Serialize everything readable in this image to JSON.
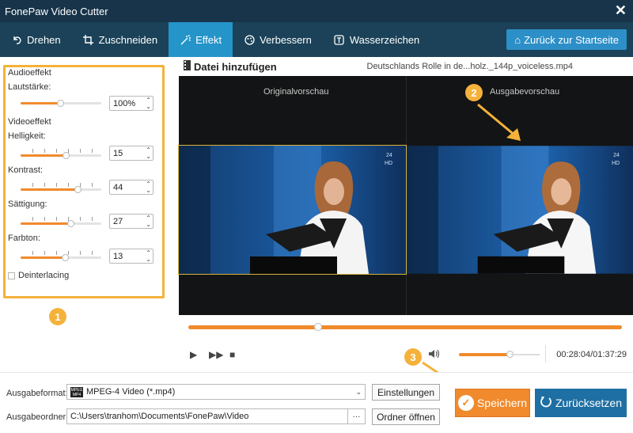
{
  "app": {
    "title": "FonePaw Video Cutter"
  },
  "toolbar": {
    "tabs": [
      {
        "label": "Drehen",
        "icon": "rotate-icon"
      },
      {
        "label": "Zuschneiden",
        "icon": "crop-icon"
      },
      {
        "label": "Effekt",
        "icon": "effect-icon",
        "active": true
      },
      {
        "label": "Verbessern",
        "icon": "palette-icon"
      },
      {
        "label": "Wasserzeichen",
        "icon": "watermark-icon"
      }
    ],
    "home_label": "Zurück zur Startseite"
  },
  "colors": {
    "accent_orange": "#f08a2c",
    "tab_active": "#2594c9",
    "toolbar_bg": "#1b4258",
    "title_bg": "#17344a",
    "highlight_yellow": "#f4b23b"
  },
  "left_panel": {
    "audio_section": "Audioeffekt",
    "volume": {
      "label": "Lautstärke:",
      "value": "100%",
      "level": 0.5
    },
    "video_section": "Videoeffekt",
    "brightness": {
      "label": "Helligkeit:",
      "value": "15",
      "level": 0.57
    },
    "contrast": {
      "label": "Kontrast:",
      "value": "44",
      "level": 0.72
    },
    "saturation": {
      "label": "Sättigung:",
      "value": "27",
      "level": 0.63
    },
    "hue": {
      "label": "Farbton:",
      "value": "13",
      "level": 0.56
    },
    "deinterlacing": {
      "label": "Deinterlacing",
      "checked": false
    }
  },
  "badges": {
    "one": "1",
    "two": "2",
    "three": "3"
  },
  "file": {
    "add_label": "Datei hinzufügen",
    "name": "Deutschlands Rolle in de...holz._144p_voiceless.mp4"
  },
  "preview": {
    "original_label": "Originalvorschau",
    "output_label": "Ausgabevorschau"
  },
  "player": {
    "progress": 0.3,
    "volume": 0.85,
    "timecode": "00:28:04/01:37:29"
  },
  "output": {
    "format_label": "Ausgabeformat:",
    "format_value": "MPEG-4 Video (*.mp4)",
    "settings_button": "Einstellungen",
    "folder_label": "Ausgabeordner:",
    "folder_value": "C:\\Users\\tranhom\\Documents\\FonePaw\\Video",
    "open_folder_button": "Ordner öffnen",
    "browse_label": "···",
    "save_button": "Speichern",
    "reset_button": "Zurücksetzen"
  }
}
